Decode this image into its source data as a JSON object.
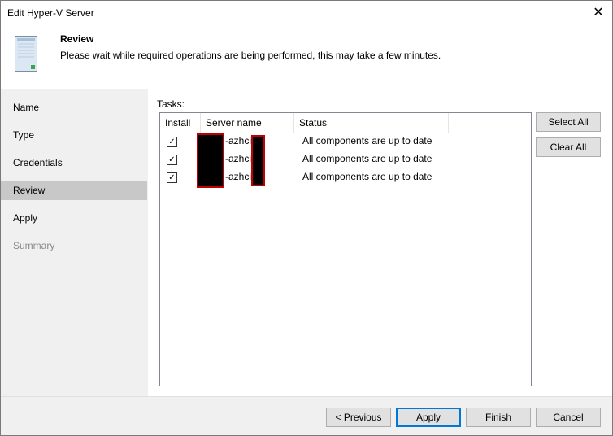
{
  "window": {
    "title": "Edit Hyper-V Server",
    "close_glyph": "✕"
  },
  "header": {
    "title": "Review",
    "subtitle": "Please wait while required operations are being performed, this may take a few minutes."
  },
  "sidebar": {
    "items": [
      {
        "label": "Name",
        "state": "normal"
      },
      {
        "label": "Type",
        "state": "normal"
      },
      {
        "label": "Credentials",
        "state": "normal"
      },
      {
        "label": "Review",
        "state": "active"
      },
      {
        "label": "Apply",
        "state": "normal"
      },
      {
        "label": "Summary",
        "state": "disabled"
      }
    ]
  },
  "tasks": {
    "label": "Tasks:",
    "columns": [
      "Install",
      "Server name",
      "Status"
    ],
    "rows": [
      {
        "checked": true,
        "server_name": "-azhci",
        "status": "All components are up to date"
      },
      {
        "checked": true,
        "server_name": "-azhci",
        "status": "All components are up to date"
      },
      {
        "checked": true,
        "server_name": "-azhci",
        "status": "All components are up to date"
      }
    ],
    "select_all_label": "Select All",
    "clear_all_label": "Clear All"
  },
  "footer": {
    "previous_label": "< Previous",
    "apply_label": "Apply",
    "finish_label": "Finish",
    "cancel_label": "Cancel"
  },
  "colors": {
    "accent": "#0078d7",
    "redaction_border": "#c00000",
    "active_nav_bg": "#c8c8c8"
  }
}
